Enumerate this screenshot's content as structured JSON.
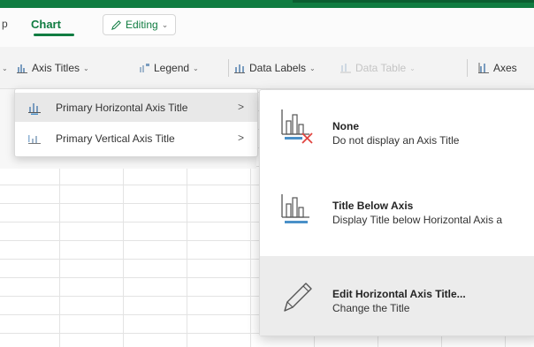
{
  "ribbon": {
    "tabs": [
      {
        "label": "p"
      },
      {
        "label": "Chart"
      }
    ],
    "editing_mode": "Editing",
    "commands": [
      {
        "label": "Axis Titles"
      },
      {
        "label": "Legend"
      },
      {
        "label": "Data Labels"
      },
      {
        "label": "Data Table"
      },
      {
        "label": "Axes"
      }
    ]
  },
  "axis_titles_menu": {
    "items": [
      {
        "label": "Primary Horizontal Axis Title"
      },
      {
        "label": "Primary Vertical Axis Title"
      }
    ]
  },
  "horizontal_title_flyout": {
    "options": [
      {
        "title": "None",
        "description": "Do not display an Axis Title",
        "icon": "chart-no-title-icon"
      },
      {
        "title": "Title Below Axis",
        "description": "Display Title below Horizontal Axis a",
        "icon": "chart-title-below-icon"
      },
      {
        "title": "Edit Horizontal Axis Title...",
        "description": "Change the Title",
        "icon": "pencil-icon"
      }
    ]
  },
  "colors": {
    "accent": "#107c41",
    "remove_x": "#e0443f",
    "axis_blue": "#4a90c8"
  }
}
